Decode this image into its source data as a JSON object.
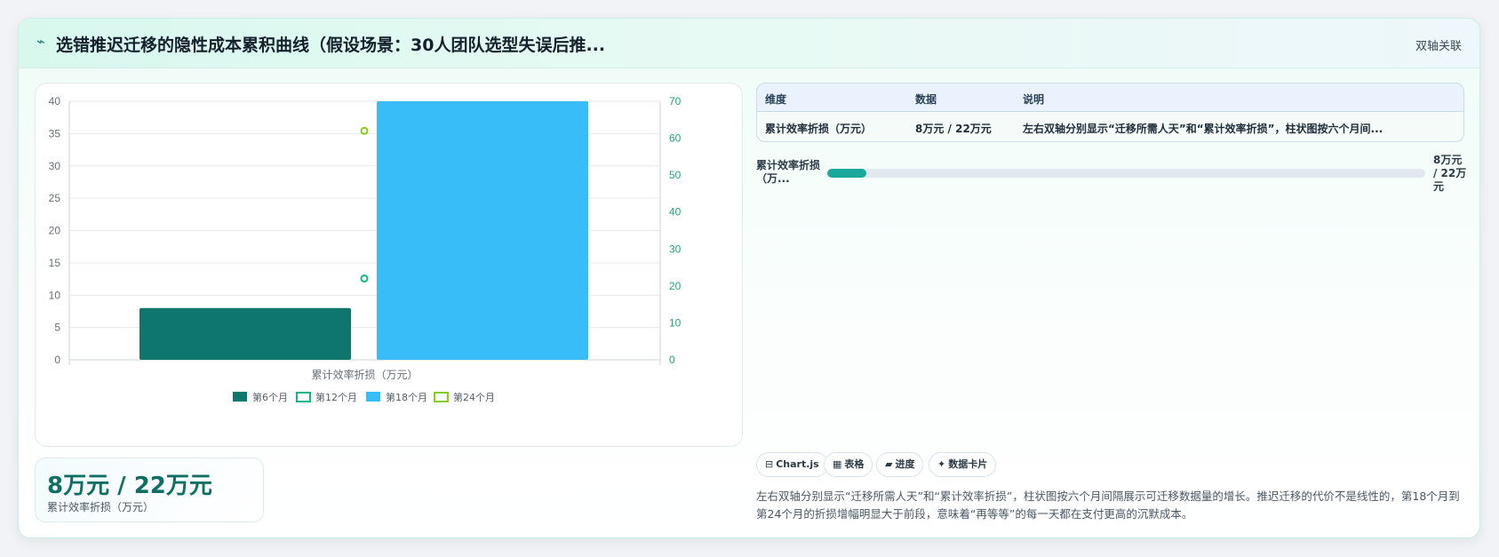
{
  "card": {
    "title_icon": "⌁",
    "title": "选错推迟迁移的隐性成本累积曲线（假设场景：30人团队选型失误后推...",
    "header_tag": "双轴关联"
  },
  "chart_data": {
    "type": "bar",
    "category": "累计效率折损（万元）",
    "left_axis": {
      "ticks": [
        0,
        5,
        10,
        15,
        20,
        25,
        30,
        35,
        40
      ],
      "ylim": [
        0,
        40
      ]
    },
    "right_axis": {
      "ticks": [
        0,
        10,
        20,
        30,
        40,
        50,
        60,
        70
      ],
      "ylim": [
        0,
        70
      ]
    },
    "series": [
      {
        "name": "第6个月",
        "kind": "bar",
        "axis": "left",
        "value": 8,
        "color": "#0f766e",
        "legend_style": "filled"
      },
      {
        "name": "第12个月",
        "kind": "point",
        "axis": "right",
        "value": 22,
        "color": "#10b981",
        "legend_style": "outline"
      },
      {
        "name": "第18个月",
        "kind": "bar",
        "axis": "left",
        "value": 40,
        "color": "#38bdf8",
        "legend_style": "filled"
      },
      {
        "name": "第24个月",
        "kind": "point",
        "axis": "right",
        "value": 62,
        "color": "#84cc16",
        "legend_style": "outline"
      }
    ],
    "grid": true,
    "legend_position": "bottom"
  },
  "stat": {
    "value": "8万元 / 22万元",
    "label": "累计效率折损（万元）"
  },
  "table": {
    "headers": [
      "维度",
      "数据",
      "说明"
    ],
    "rows": [
      [
        "累计效率折损（万元）",
        "8万元 / 22万元",
        "左右双轴分别显示“迁移所需人天”和“累计效率折损”，柱状图按六个月间..."
      ]
    ]
  },
  "progress": {
    "label": "累计效率折损（万...",
    "value_text": "8万元 / 22万元",
    "fraction": 0.065
  },
  "chips": [
    {
      "icon": "⊟",
      "icon_name": "chart-icon",
      "label": "Chart.js"
    },
    {
      "icon": "▦",
      "icon_name": "table-icon",
      "label": "表格"
    },
    {
      "icon": "▰",
      "icon_name": "progress-icon",
      "label": "进度"
    },
    {
      "icon": "✦",
      "icon_name": "sparkle-icon",
      "label": "数据卡片"
    }
  ],
  "description": "左右双轴分别显示“迁移所需人天”和“累计效率折损”，柱状图按六个月间隔展示可迁移数据量的增长。推迟迁移的代价不是线性的，第18个月到第24个月的折损增幅明显大于前段，意味着“再等等”的每一天都在支付更高的沉默成本。"
}
